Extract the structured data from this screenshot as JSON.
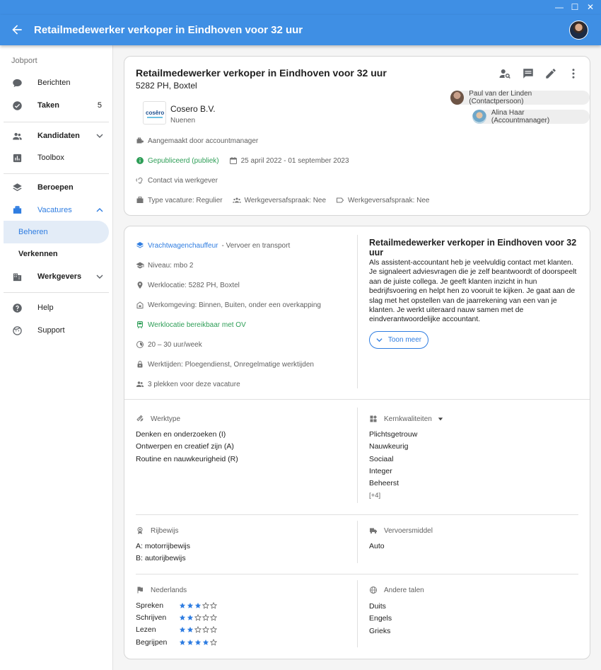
{
  "window": {
    "minimize": "—",
    "maximize": "☐",
    "close": "✕"
  },
  "appbar": {
    "title": "Retailmedewerker verkoper in Eindhoven voor 32 uur"
  },
  "sidebar": {
    "section": "Jobport",
    "items": [
      {
        "label": "Berichten"
      },
      {
        "label": "Taken",
        "count": "5"
      },
      {
        "label": "Kandidaten"
      },
      {
        "label": "Toolbox"
      },
      {
        "label": "Beroepen"
      },
      {
        "label": "Vacatures"
      },
      {
        "label": "Beheren"
      },
      {
        "label": "Verkennen"
      },
      {
        "label": "Werkgevers"
      },
      {
        "label": "Help"
      },
      {
        "label": "Support"
      }
    ]
  },
  "header_card": {
    "title": "Retailmedewerker verkoper in Eindhoven voor 32 uur",
    "location": "5282 PH, Boxtel",
    "contacts": [
      {
        "name": "Paul van der Linden (Contactpersoon)"
      },
      {
        "name": "Alina Haar (Accountmanager)"
      }
    ],
    "company": "Cosero B.V.",
    "company_place": "Nuenen",
    "logo_text": "cosêro",
    "created": "Aangemaakt door accountmanager",
    "status": "Gepubliceerd (publiek)",
    "period": "25 april 2022 - 01 september 2023",
    "contact_via": "Contact via werkgever",
    "type": "Type vacature: Regulier",
    "agreement_1": "Werkgeversafspraak: Nee",
    "agreement_2": "Werkgeversafspraak: Nee"
  },
  "detail_card": {
    "occupation": "Vrachtwagenchauffeur",
    "sector": "- Vervoer en transport",
    "level": "Niveau: mbo 2",
    "work_location": "Werklocatie: 5282 PH, Boxtel",
    "environment": "Werkomgeving: Binnen, Buiten, onder een overkapping",
    "ov": "Werklocatie bereikbaar met OV",
    "hours": "20 – 30 uur/week",
    "work_times": "Werktijden: Ploegendienst, Onregelmatige werktijden",
    "places": "3 plekken voor deze vacature",
    "desc_title": "Retailmedewerker verkoper in Eindhoven voor 32 uur",
    "description": "Als assistent-accountant heb je veelvuldig contact met klanten. Je signaleert adviesvragen die je zelf beantwoordt of doorspeelt aan de juiste collega. Je geeft klanten inzicht in hun bedrijfsvoering en helpt hen zo vooruit te kijken. Je gaat aan de slag met het opstellen van de jaarrekening van een van je klanten. Je werkt uiteraard nauw samen met de eindverantwoordelijke accountant.",
    "show_more": "Toon meer",
    "werktype_label": "Werktype",
    "werktype": [
      "Denken en onderzoeken (I)",
      "Ontwerpen en creatief zijn (A)",
      "Routine en nauwkeurigheid (R)"
    ],
    "kern_label": "Kernkwaliteiten",
    "kern": [
      "Plichtsgetrouw",
      "Nauwkeurig",
      "Sociaal",
      "Integer",
      "Beheerst"
    ],
    "kern_more": "[+4]",
    "rijbewijs_label": "Rijbewijs",
    "rijbewijs": [
      "A: motorrijbewijs",
      "B: autorijbewijs"
    ],
    "vervoer_label": "Vervoersmiddel",
    "vervoer": [
      "Auto"
    ],
    "nl_label": "Nederlands",
    "nl_skills": [
      {
        "name": "Spreken",
        "stars": 3
      },
      {
        "name": "Schrijven",
        "stars": 2
      },
      {
        "name": "Lezen",
        "stars": 2
      },
      {
        "name": "Begrijpen",
        "stars": 4
      }
    ],
    "other_label": "Andere talen",
    "other_langs": [
      "Duits",
      "Engels",
      "Grieks"
    ]
  },
  "colors": {
    "primary": "#3f8fe4",
    "accent": "#2f7de1",
    "success": "#2e9e57"
  }
}
